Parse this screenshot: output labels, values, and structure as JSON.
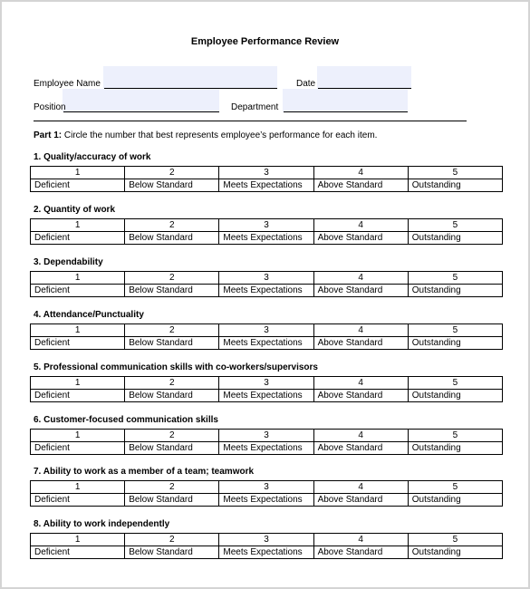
{
  "document": {
    "title": "Employee Performance Review",
    "fields": {
      "employee_name_label": "Employee Name",
      "employee_name_value": "",
      "date_label": "Date",
      "date_value": "",
      "position_label": "Position",
      "position_value": "",
      "department_label": "Department",
      "department_value": ""
    },
    "part1": {
      "label": "Part 1:",
      "instruction": " Circle the number that best represents employee’s performance for each item."
    },
    "scale": {
      "numbers": [
        "1",
        "2",
        "3",
        "4",
        "5"
      ],
      "descriptions": [
        "Deficient",
        "Below Standard",
        "Meets Expectations",
        "Above Standard",
        "Outstanding"
      ]
    },
    "sections": [
      {
        "title": "1. Quality/accuracy of work"
      },
      {
        "title": "2. Quantity of work"
      },
      {
        "title": "3. Dependability"
      },
      {
        "title": "4. Attendance/Punctuality"
      },
      {
        "title": "5. Professional communication skills with co-workers/supervisors"
      },
      {
        "title": "6. Customer-focused communication skills"
      },
      {
        "title": "7. Ability to work as a member of a team; teamwork"
      },
      {
        "title": "8. Ability to work independently"
      }
    ]
  }
}
